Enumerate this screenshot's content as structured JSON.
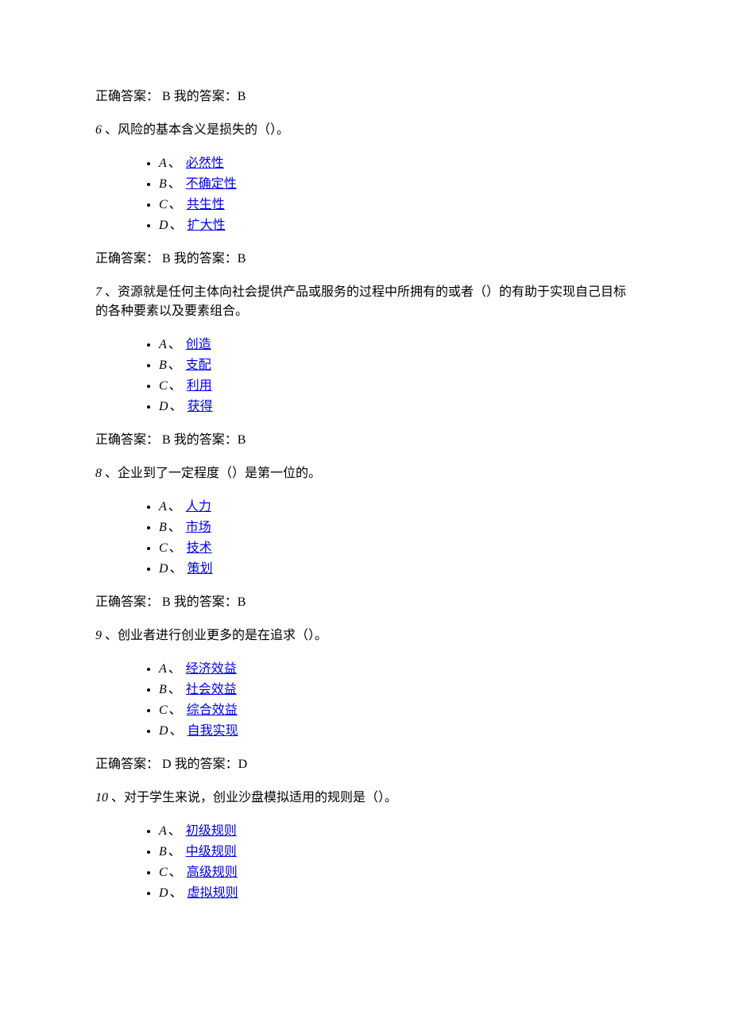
{
  "strings": {
    "correct_label": "正确答案：",
    "my_label": "我的答案：",
    "sep": "、"
  },
  "blocks": [
    {
      "pre_answer": {
        "correct": " B ",
        "mine": "B"
      },
      "qnum": "6 ",
      "qtext": "、风险的基本含义是损失的（）。",
      "options": [
        {
          "label": "A",
          "text": "必然性"
        },
        {
          "label": "B",
          "text": "不确定性"
        },
        {
          "label": "C",
          "text": "共生性"
        },
        {
          "label": "D",
          "text": "扩大性"
        }
      ],
      "post_answer": {
        "correct": " B ",
        "mine": "B"
      }
    },
    {
      "qnum": "7 ",
      "qtext": "、资源就是任何主体向社会提供产品或服务的过程中所拥有的或者（）的有助于实现自己目标的各种要素以及要素组合。",
      "options": [
        {
          "label": "A",
          "text": "创造"
        },
        {
          "label": "B",
          "text": "支配"
        },
        {
          "label": "C",
          "text": "利用"
        },
        {
          "label": "D",
          "text": "获得"
        }
      ],
      "post_answer": {
        "correct": " B ",
        "mine": "B"
      }
    },
    {
      "qnum": "8 ",
      "qtext": "、企业到了一定程度（）是第一位的。",
      "options": [
        {
          "label": "A",
          "text": "人力"
        },
        {
          "label": "B",
          "text": "市场"
        },
        {
          "label": "C",
          "text": "技术"
        },
        {
          "label": "D",
          "text": "策划"
        }
      ],
      "post_answer": {
        "correct": " B ",
        "mine": "B"
      }
    },
    {
      "qnum": "9 ",
      "qtext": "、创业者进行创业更多的是在追求（）。",
      "options": [
        {
          "label": "A",
          "text": "经济效益"
        },
        {
          "label": "B",
          "text": "社会效益"
        },
        {
          "label": "C",
          "text": "综合效益"
        },
        {
          "label": "D",
          "text": "自我实现"
        }
      ],
      "post_answer": {
        "correct": " D ",
        "mine": "D"
      }
    },
    {
      "qnum": "10 ",
      "qtext": "、对于学生来说，创业沙盘模拟适用的规则是（）。",
      "options": [
        {
          "label": "A",
          "text": "初级规则"
        },
        {
          "label": "B",
          "text": "中级规则"
        },
        {
          "label": "C",
          "text": "高级规则"
        },
        {
          "label": "D",
          "text": "虚拟规则"
        }
      ]
    }
  ]
}
